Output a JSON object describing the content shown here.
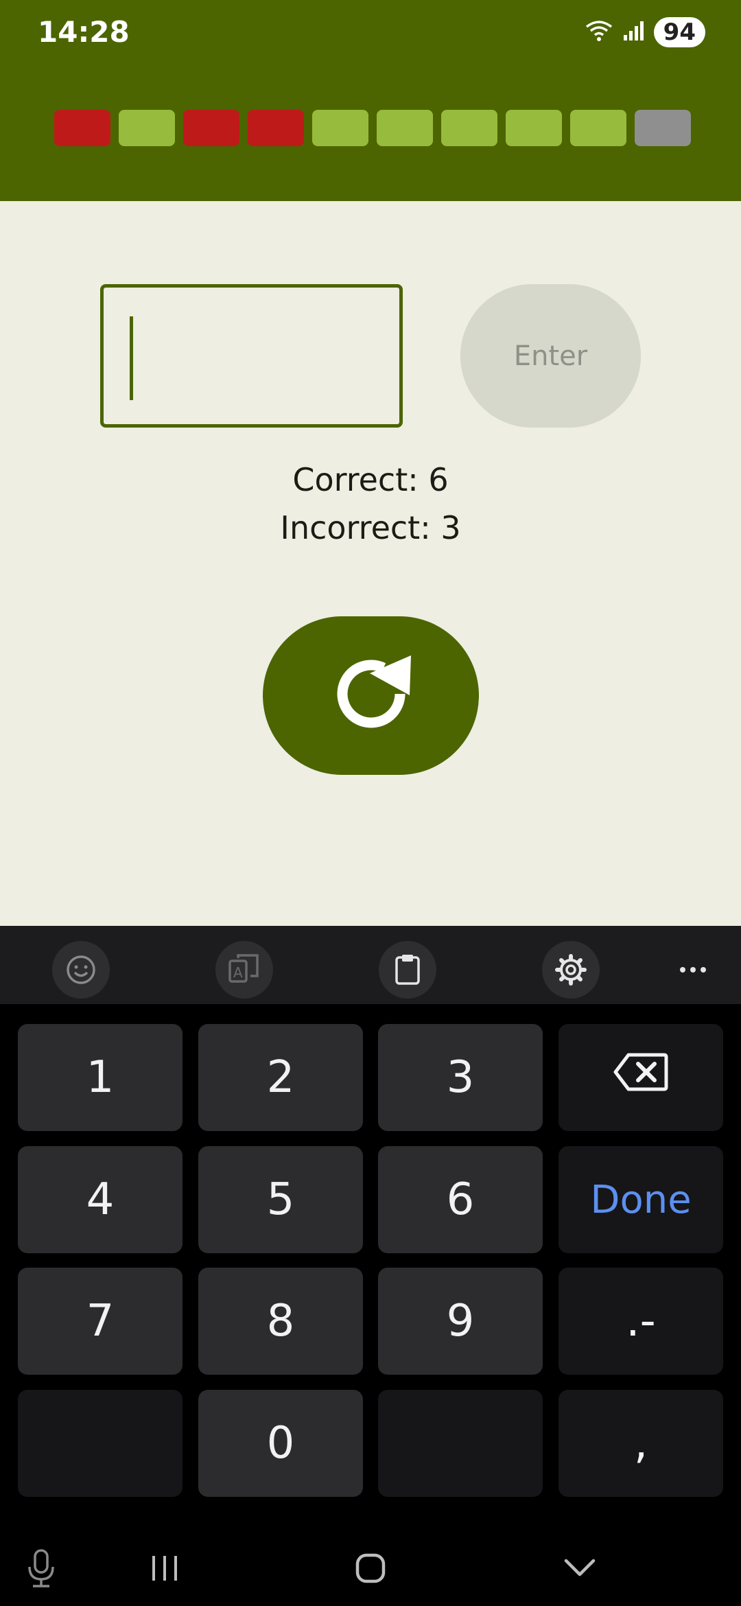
{
  "status_bar": {
    "time": "14:28",
    "wifi_icon": "wifi-icon",
    "signal_icon": "cell-signal-icon",
    "battery": "94"
  },
  "progress": {
    "segments": [
      "incorrect",
      "correct",
      "incorrect",
      "incorrect",
      "correct",
      "correct",
      "correct",
      "correct",
      "correct",
      "pending"
    ],
    "colors": {
      "incorrect": "#bf1a1a",
      "correct": "#97bb3c",
      "pending": "#8f8f8f"
    }
  },
  "answer": {
    "value": "",
    "enter_label": "Enter"
  },
  "score": {
    "correct": "Correct: 6",
    "incorrect": "Incorrect: 3"
  },
  "reset_icon": "refresh-icon",
  "keyboard": {
    "toolbar": [
      "emoji-icon",
      "translate-icon",
      "clipboard-icon",
      "settings-icon",
      "more-icon"
    ],
    "rows": [
      [
        "1",
        "2",
        "3",
        "backspace"
      ],
      [
        "4",
        "5",
        "6",
        "Done"
      ],
      [
        "7",
        "8",
        "9",
        ".-"
      ],
      [
        "",
        "0",
        "",
        ","
      ]
    ]
  },
  "nav": [
    "mic-icon",
    "recents-icon",
    "home-icon",
    "hide-keyboard-icon"
  ],
  "colors": {
    "header": "#4c6500",
    "background": "#eeeee2",
    "accent": "#4c6500",
    "done_text": "#5c90f0"
  }
}
